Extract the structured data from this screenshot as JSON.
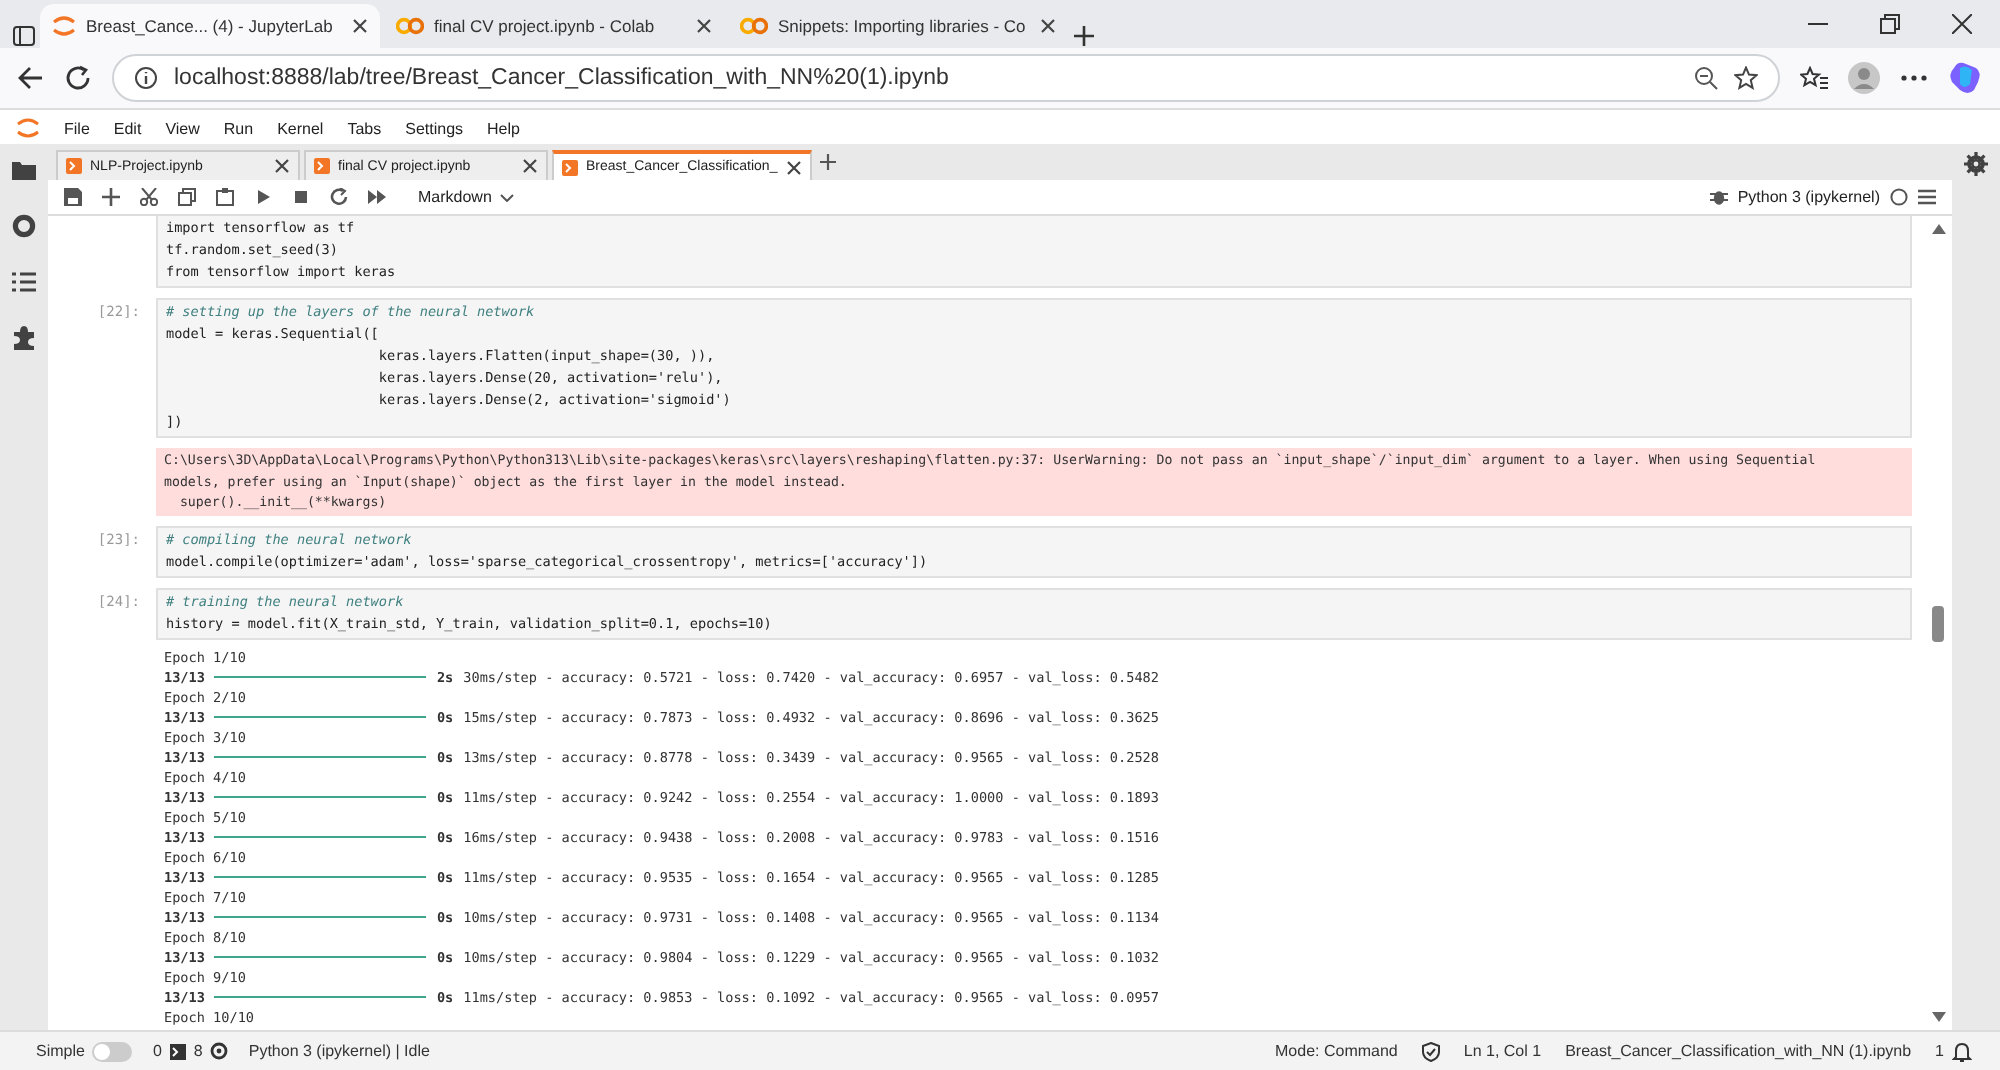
{
  "browser": {
    "tabs": [
      {
        "title": "Breast_Cance... (4) - JupyterLab",
        "selected": true,
        "kind": "jupyter"
      },
      {
        "title": "final CV project.ipynb - Colab",
        "selected": false,
        "kind": "colab"
      },
      {
        "title": "Snippets: Importing libraries - Co",
        "selected": false,
        "kind": "colab"
      }
    ],
    "address": "localhost:8888/lab/tree/Breast_Cancer_Classification_with_NN%20(1).ipynb"
  },
  "menu": [
    "File",
    "Edit",
    "View",
    "Run",
    "Kernel",
    "Tabs",
    "Settings",
    "Help"
  ],
  "notebook_tabs": [
    {
      "label": "NLP-Project.ipynb",
      "selected": false
    },
    {
      "label": "final CV project.ipynb",
      "selected": false
    },
    {
      "label": "Breast_Cancer_Classification_",
      "selected": true
    }
  ],
  "toolbar": {
    "cell_type": "Markdown",
    "kernel": "Python 3 (ipykernel)"
  },
  "cells": [
    {
      "code": [
        "import tensorflow as tf",
        "tf.random.set_seed(3)",
        "from tensorflow import keras"
      ]
    },
    {
      "prompt": "[22]:",
      "comment": "# setting up the layers of the neural network",
      "code": [
        "model = keras.Sequential([",
        "                          keras.layers.Flatten(input_shape=(30, )),",
        "                          keras.layers.Dense(20, activation='relu'),",
        "                          keras.layers.Dense(2, activation='sigmoid')",
        "])"
      ],
      "warning": [
        "C:\\Users\\3D\\AppData\\Local\\Programs\\Python\\Python313\\Lib\\site-packages\\keras\\src\\layers\\reshaping\\flatten.py:37: UserWarning: Do not pass an `input_shape`/`input_dim` argument to a layer. When using Sequential",
        "models, prefer using an `Input(shape)` object as the first layer in the model instead.",
        "  super().__init__(**kwargs)"
      ]
    },
    {
      "prompt": "[23]:",
      "comment": "# compiling the neural network",
      "code": [
        "model.compile(optimizer='adam', loss='sparse_categorical_crossentropy', metrics=['accuracy'])"
      ]
    },
    {
      "prompt": "[24]:",
      "comment": "# training the neural network",
      "code": [
        "history = model.fit(X_train_std, Y_train, validation_split=0.1, epochs=10)"
      ],
      "epochs": [
        {
          "epoch": "Epoch 1/10",
          "steps": "13/13",
          "level": 1,
          "time": "2s",
          "stats": "30ms/step - accuracy: 0.5721 - loss: 0.7420 - val_accuracy: 0.6957 - val_loss: 0.5482"
        },
        {
          "epoch": "Epoch 2/10",
          "steps": "13/13",
          "level": 1,
          "time": "0s",
          "stats": "15ms/step - accuracy: 0.7873 - loss: 0.4932 - val_accuracy: 0.8696 - val_loss: 0.3625"
        },
        {
          "epoch": "Epoch 3/10",
          "steps": "13/13",
          "level": 1,
          "time": "0s",
          "stats": "13ms/step - accuracy: 0.8778 - loss: 0.3439 - val_accuracy: 0.9565 - val_loss: 0.2528"
        },
        {
          "epoch": "Epoch 4/10",
          "steps": "13/13",
          "level": 1,
          "time": "0s",
          "stats": "11ms/step - accuracy: 0.9242 - loss: 0.2554 - val_accuracy: 1.0000 - val_loss: 0.1893"
        },
        {
          "epoch": "Epoch 5/10",
          "steps": "13/13",
          "level": 1,
          "time": "0s",
          "stats": "16ms/step - accuracy: 0.9438 - loss: 0.2008 - val_accuracy: 0.9783 - val_loss: 0.1516"
        },
        {
          "epoch": "Epoch 6/10",
          "steps": "13/13",
          "level": 1,
          "time": "0s",
          "stats": "11ms/step - accuracy: 0.9535 - loss: 0.1654 - val_accuracy: 0.9565 - val_loss: 0.1285"
        },
        {
          "epoch": "Epoch 7/10",
          "steps": "13/13",
          "level": 1,
          "time": "0s",
          "stats": "10ms/step - accuracy: 0.9731 - loss: 0.1408 - val_accuracy: 0.9565 - val_loss: 0.1134"
        },
        {
          "epoch": "Epoch 8/10",
          "steps": "13/13",
          "level": 1,
          "time": "0s",
          "stats": "10ms/step - accuracy: 0.9804 - loss: 0.1229 - val_accuracy: 0.9565 - val_loss: 0.1032"
        },
        {
          "epoch": "Epoch 9/10",
          "steps": "13/13",
          "level": 1,
          "time": "0s",
          "stats": "11ms/step - accuracy: 0.9853 - loss: 0.1092 - val_accuracy: 0.9565 - val_loss: 0.0957"
        },
        {
          "epoch": "Epoch 10/10"
        }
      ]
    }
  ],
  "status_bar": {
    "simple_mode": false,
    "simple_label": "Simple",
    "terminals": "0",
    "kernels": "8",
    "kernel_status": "Python 3 (ipykernel) | Idle",
    "mode": "Mode: Command",
    "position": "Ln 1, Col 1",
    "file": "Breast_Cancer_Classification_with_NN (1).ipynb",
    "notifications": "1"
  }
}
